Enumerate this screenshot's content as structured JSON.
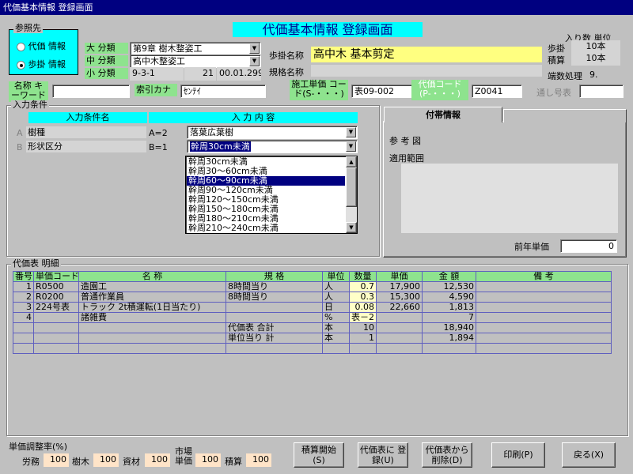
{
  "window": {
    "title": "代価基本情報 登録画面"
  },
  "header": {
    "title": "代価基本情報 登録画面"
  },
  "ref": {
    "group_title": "参照先",
    "option1": "代価 情報",
    "option2": "歩掛 情報",
    "selected": "option2"
  },
  "classification": {
    "dai_label": "大 分類",
    "dai_value": "第9章 樹木整姿工",
    "chu_label": "中 分類",
    "chu_value": "高中木整姿工",
    "sho_label": "小 分類",
    "sho_code": "9-3-1",
    "sho_num": "21",
    "sho_date": "00.01.299"
  },
  "buhu": {
    "name_label": "歩掛名称",
    "name_value": "高中木 基本剪定",
    "spec_label": "規格名称",
    "spec_value": ""
  },
  "right_info": {
    "header": "入り数 単位",
    "buhu_label": "歩掛",
    "buhu_value": "10本",
    "sekisan_label": "積算",
    "sekisan_value": "10本",
    "rounding_label": "端数処理",
    "rounding_value": "9."
  },
  "row2": {
    "keyword_label": "名称 キーワード",
    "keyword_value": "",
    "kana_label": "索引カナ",
    "kana_value": "ｾﾝﾃｲ",
    "unitcode_label": "施工単価 コード(S-・・・)",
    "unitcode_value": "表09-002",
    "daikacode_label": "代価コード (P-・・・)",
    "daikacode_value": "Z0041",
    "serial_label": "通し号表",
    "serial_value": ""
  },
  "conditions": {
    "group_title": "入力条件",
    "col1": "入力条件名",
    "col2": "入 力 内 容",
    "rows": [
      {
        "letter": "A",
        "name": "樹種",
        "code": "A=2",
        "value": "落葉広葉樹"
      },
      {
        "letter": "B",
        "name": "形状区分",
        "code": "B=1",
        "value": "幹周30cm未満"
      }
    ],
    "list_options": [
      "幹周30cm未満",
      "幹周30～60cm未満",
      "幹周60～90cm未満",
      "幹周90～120cm未満",
      "幹周120～150cm未満",
      "幹周150～180cm未満",
      "幹周180～210cm未満",
      "幹周210～240cm未満"
    ],
    "list_selected_index": 2
  },
  "attached": {
    "tab_label": "付帯情報",
    "ref_label": "参 考 図",
    "range_label": "適用範囲",
    "prev_price_label": "前年単価",
    "prev_price_value": "0"
  },
  "detail": {
    "group_title": "代価表 明細",
    "headers": [
      "番号",
      "単価コード",
      "名 称",
      "規 格",
      "単位",
      "数量",
      "単価",
      "金 額",
      "備 考"
    ],
    "rows": [
      [
        "1",
        "R0500",
        "造園工",
        "8時間当り",
        "人",
        "0.7",
        "17,900",
        "12,530",
        ""
      ],
      [
        "2",
        "R0200",
        "普通作業員",
        "8時間当り",
        "人",
        "0.3",
        "15,300",
        "4,590",
        ""
      ],
      [
        "3",
        "224号表",
        "トラック 2t積運転(1日当たり)",
        "",
        "日",
        "0.08",
        "22,660",
        "1,813",
        ""
      ],
      [
        "4",
        "",
        "諸雑費",
        "",
        "%",
        "表－2",
        "",
        "7",
        ""
      ],
      [
        "",
        "",
        "",
        "代価表 合計",
        "本",
        "10",
        "",
        "18,940",
        ""
      ],
      [
        "",
        "",
        "",
        "単位当り 計",
        "本",
        "1",
        "",
        "1,894",
        ""
      ],
      [
        "",
        "",
        "",
        "",
        "",
        "",
        "",
        "",
        ""
      ]
    ]
  },
  "footer": {
    "rate_label": "単価調整率(%)",
    "labor_label": "労務",
    "labor_value": "100",
    "tree_label": "樹木",
    "tree_value": "100",
    "material_label": "資材",
    "material_value": "100",
    "market_label": "市場 単価",
    "market_value": "100",
    "sekisan_label": "積算",
    "sekisan_value": "100"
  },
  "buttons": {
    "calc": "積算開始 (S)",
    "register": "代価表に 登録(U)",
    "delete": "代価表から 削除(D)",
    "print": "印刷(P)",
    "back": "戻る(X)"
  }
}
